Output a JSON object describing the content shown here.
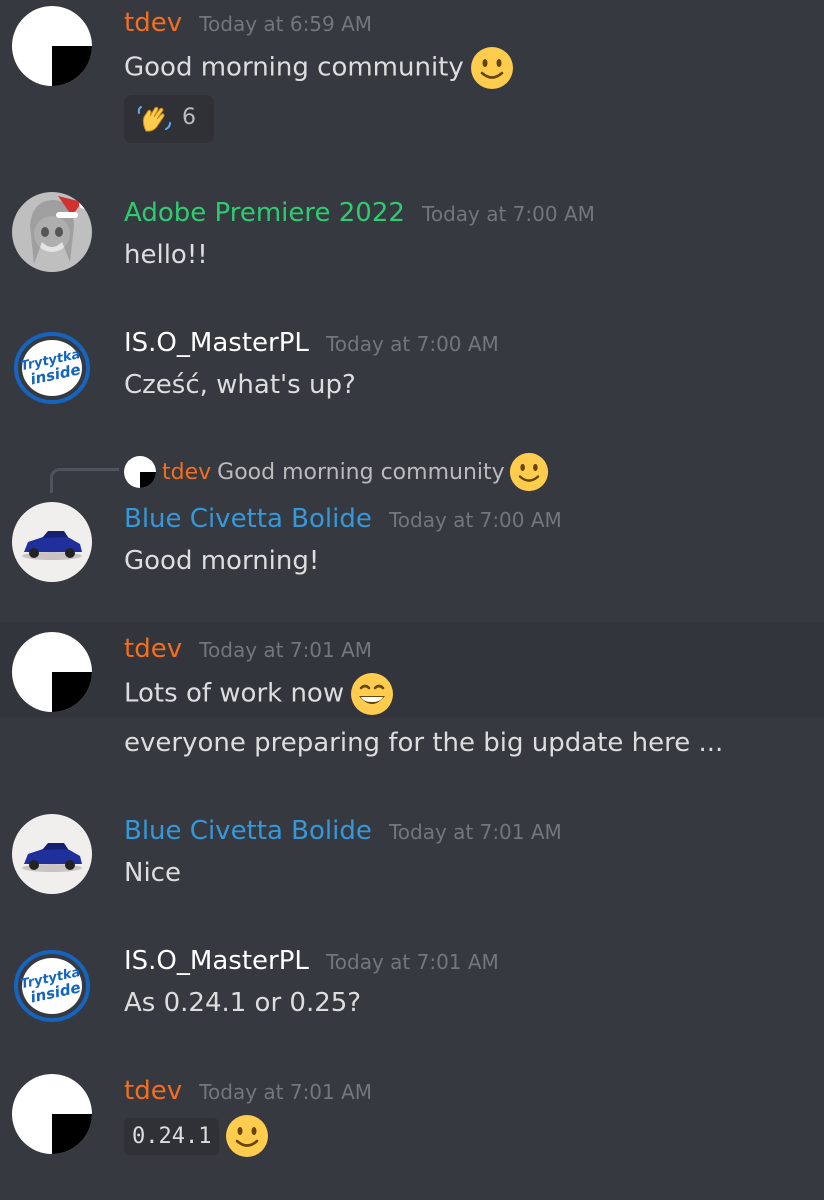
{
  "colors": {
    "background": "#36393f",
    "hover_background": "#32353b",
    "tdev": "#f46e1f",
    "adobe": "#2ecc71",
    "iso": "#ffffff",
    "blue": "#3498db",
    "timestamp": "#72767d",
    "text": "#dcddde"
  },
  "messages": [
    {
      "username": "tdev",
      "timestamp": "Today at 6:59 AM",
      "text": "Good morning community",
      "emoji": "slightly-smiling-face-icon",
      "reaction": {
        "emoji": "waving-hand-icon",
        "count": "6"
      }
    },
    {
      "username": "Adobe Premiere 2022",
      "timestamp": "Today at 7:00 AM",
      "text": "hello!!"
    },
    {
      "username": "IS.O_MasterPL",
      "timestamp": "Today at 7:00 AM",
      "text": "Cześć, what's up?"
    },
    {
      "reply": {
        "username": "tdev",
        "text": "Good morning community",
        "emoji": "slightly-smiling-face-icon"
      },
      "username": "Blue Civetta Bolide",
      "timestamp": "Today at 7:00 AM",
      "text": "Good morning!"
    },
    {
      "username": "tdev",
      "timestamp": "Today at 7:01 AM",
      "text": "Lots of work now",
      "emoji": "grinning-squinting-face-icon",
      "followup": "everyone preparing for the big update here ..."
    },
    {
      "username": "Blue Civetta Bolide",
      "timestamp": "Today at 7:01 AM",
      "text": "Nice"
    },
    {
      "username": "IS.O_MasterPL",
      "timestamp": "Today at 7:01 AM",
      "text": "As 0.24.1 or 0.25?"
    },
    {
      "username": "tdev",
      "timestamp": "Today at 7:01 AM",
      "code": "0.24.1",
      "emoji": "slightly-smiling-face-icon"
    }
  ]
}
